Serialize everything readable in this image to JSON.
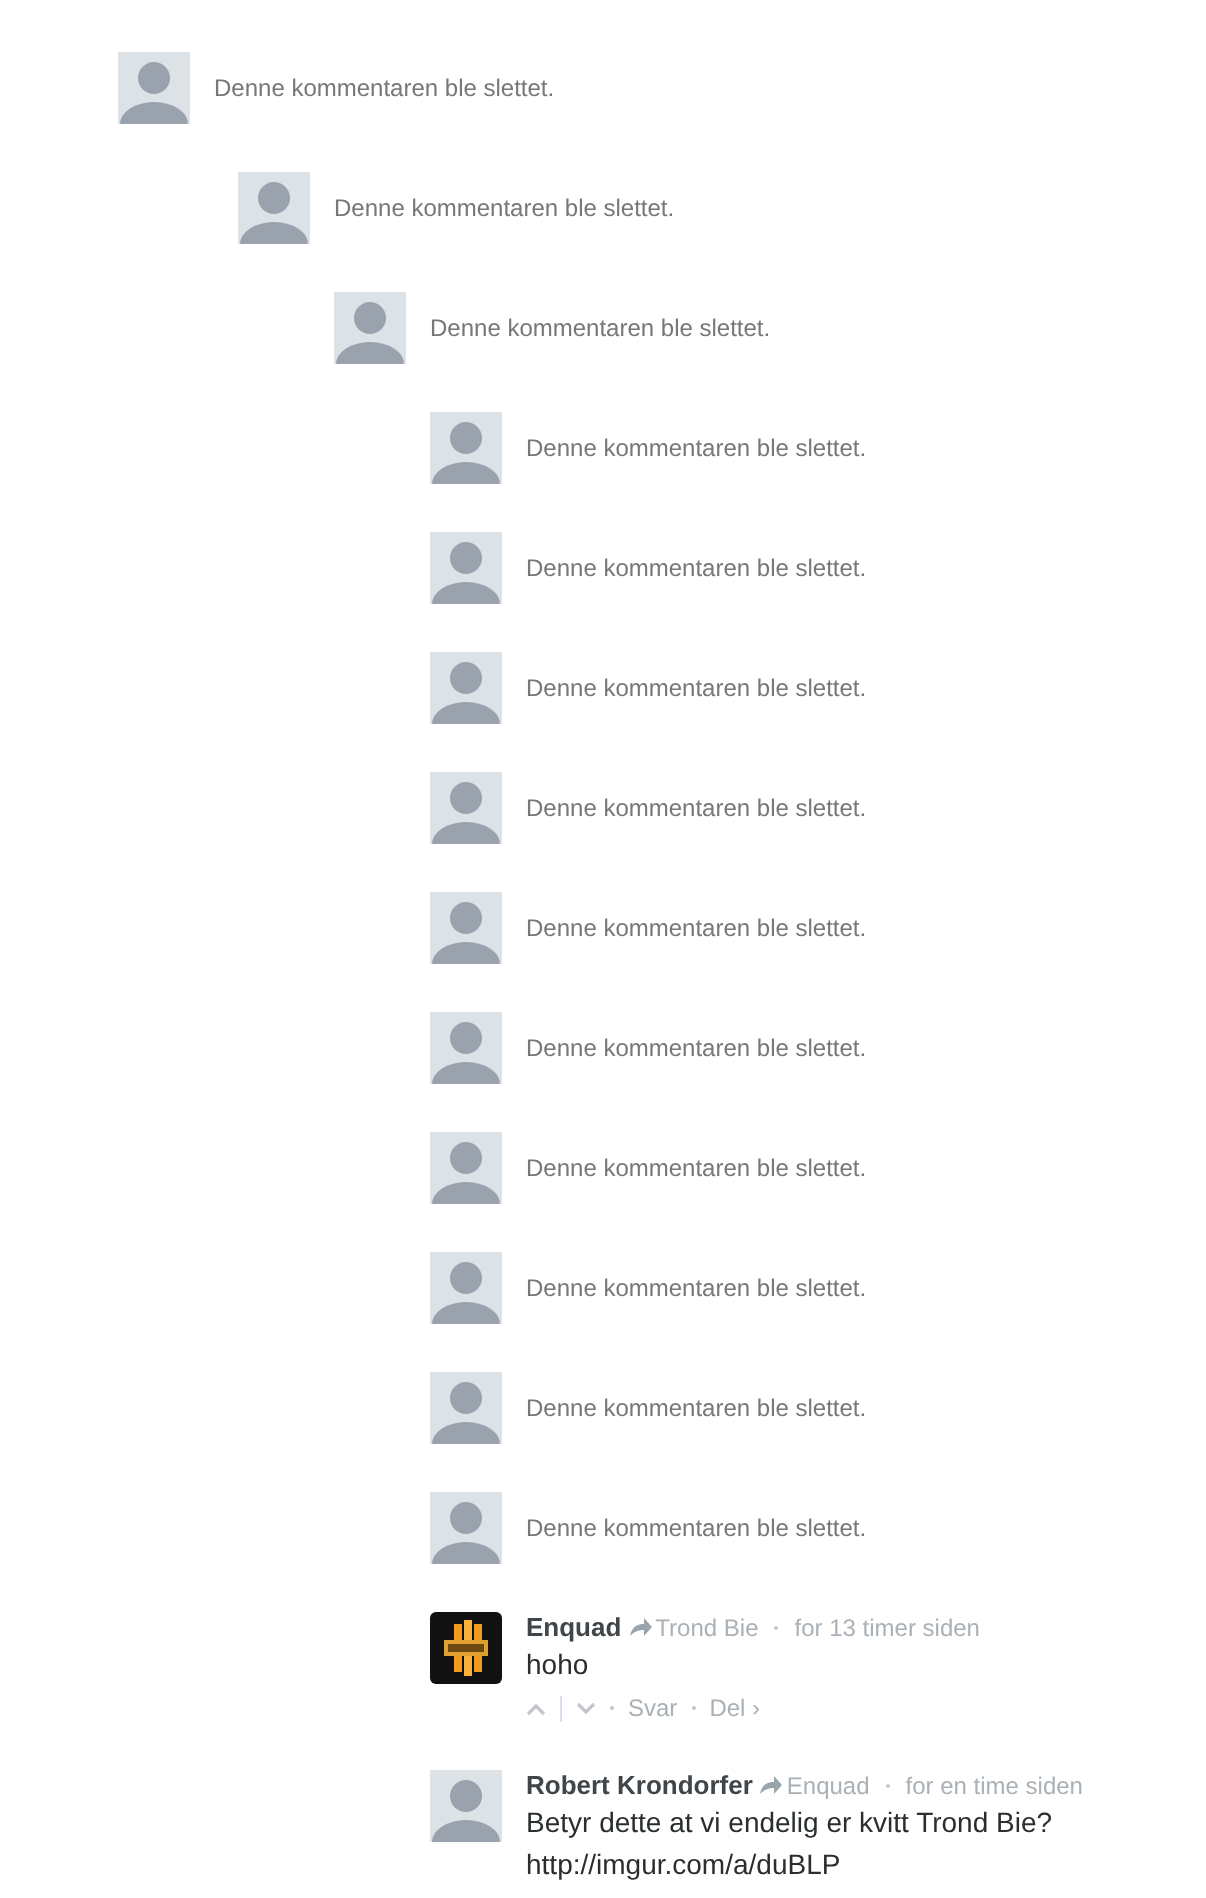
{
  "comments": [
    {
      "kind": "deleted",
      "text": "Denne kommentaren ble slettet.",
      "children": [
        {
          "kind": "deleted",
          "text": "Denne kommentaren ble slettet.",
          "children": [
            {
              "kind": "deleted",
              "text": "Denne kommentaren ble slettet.",
              "children": [
                {
                  "kind": "deleted",
                  "text": "Denne kommentaren ble slettet."
                },
                {
                  "kind": "deleted",
                  "text": "Denne kommentaren ble slettet."
                },
                {
                  "kind": "deleted",
                  "text": "Denne kommentaren ble slettet."
                },
                {
                  "kind": "deleted",
                  "text": "Denne kommentaren ble slettet."
                },
                {
                  "kind": "deleted",
                  "text": "Denne kommentaren ble slettet."
                },
                {
                  "kind": "deleted",
                  "text": "Denne kommentaren ble slettet."
                },
                {
                  "kind": "deleted",
                  "text": "Denne kommentaren ble slettet."
                },
                {
                  "kind": "deleted",
                  "text": "Denne kommentaren ble slettet."
                },
                {
                  "kind": "deleted",
                  "text": "Denne kommentaren ble slettet."
                },
                {
                  "kind": "deleted",
                  "text": "Denne kommentaren ble slettet."
                },
                {
                  "kind": "comment",
                  "custom_avatar": true,
                  "author": "Enquad",
                  "reply_to": "Trond Bie",
                  "time": "for 13 timer siden",
                  "body": [
                    "hoho"
                  ],
                  "actions": {
                    "reply": "Svar",
                    "share": "Del ›"
                  }
                },
                {
                  "kind": "comment",
                  "custom_avatar": false,
                  "author": "Robert Krondorfer",
                  "reply_to": "Enquad",
                  "time": "for en time siden",
                  "body": [
                    "Betyr dette at vi endelig er kvitt Trond Bie?",
                    "http://imgur.com/a/duBLP"
                  ]
                }
              ]
            }
          ]
        }
      ]
    }
  ]
}
